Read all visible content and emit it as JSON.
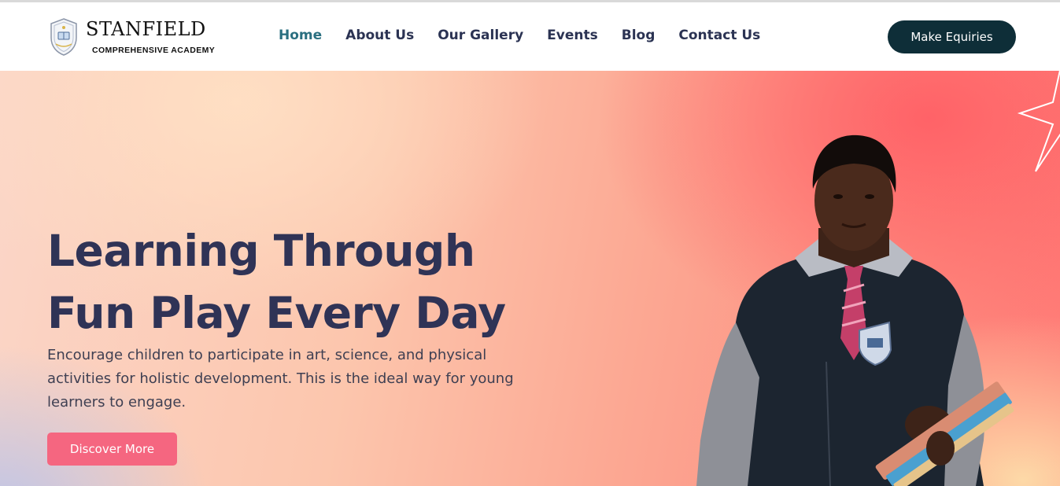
{
  "brand": {
    "name": "STANFIELD",
    "subtitle": "COMPREHENSIVE ACADEMY",
    "logo_icon": "school-crest-icon"
  },
  "nav": {
    "items": [
      {
        "label": "Home",
        "active": true
      },
      {
        "label": "About Us",
        "active": false
      },
      {
        "label": "Our Gallery",
        "active": false
      },
      {
        "label": "Events",
        "active": false
      },
      {
        "label": "Blog",
        "active": false
      },
      {
        "label": "Contact Us",
        "active": false
      }
    ]
  },
  "header": {
    "cta_label": "Make Equiries"
  },
  "hero": {
    "title_line1": "Learning Through",
    "title_line2": "Fun Play Every Day",
    "text": "Encourage children to participate in art, science, and physical activities for holistic development. This is the ideal way for young learners to engage.",
    "button_label": "Discover More",
    "image": "student-holding-books-illustration",
    "decoration": "star-outline-icon"
  },
  "colors": {
    "nav_text": "#2b3353",
    "nav_active": "#2a6f80",
    "cta_bg": "#0e2e38",
    "hero_title": "#2f3356",
    "discover_bg": "#f56680"
  }
}
